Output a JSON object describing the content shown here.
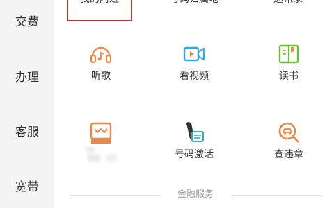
{
  "sidebar": {
    "items": [
      {
        "label": "交费"
      },
      {
        "label": "办理"
      },
      {
        "label": "客服"
      },
      {
        "label": "宽带"
      }
    ]
  },
  "top_row": {
    "items": [
      {
        "label": "我的附近"
      },
      {
        "label": "号码归属地"
      },
      {
        "label": "通讯录"
      }
    ]
  },
  "grid": {
    "row1": [
      {
        "label": "听歌",
        "icon": "headphones-music-icon",
        "color": "#e8884a"
      },
      {
        "label": "看视频",
        "icon": "video-camera-icon",
        "color": "#3aa6dd"
      },
      {
        "label": "读书",
        "icon": "book-icon",
        "color": "#6cbb3c"
      }
    ],
    "row2": [
      {
        "label": "",
        "icon": "mail-envelope-icon",
        "color": "#e8884a"
      },
      {
        "label": "号码激活",
        "icon": "sim-activation-icon",
        "color": "#3aa6dd"
      },
      {
        "label": "查违章",
        "icon": "car-search-icon",
        "color": "#e8884a"
      }
    ]
  },
  "section": {
    "title": "金融服务"
  },
  "colors": {
    "orange": "#e8884a",
    "blue": "#3aa6dd",
    "green": "#6cbb3c",
    "highlight": "#c0392b"
  }
}
